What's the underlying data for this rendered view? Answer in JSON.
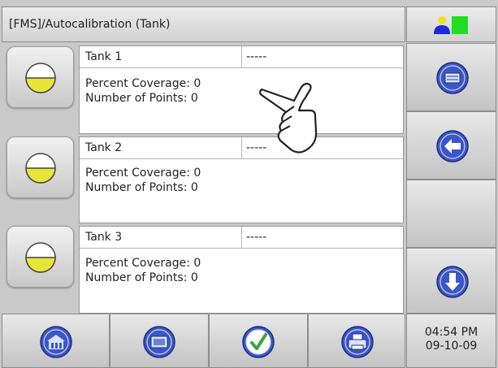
{
  "title": "[FMS]/Autocalibration (Tank)",
  "tanks": [
    {
      "name": "Tank 1",
      "value": "-----",
      "coverage": "Percent Coverage: 0",
      "points": "Number of Points: 0"
    },
    {
      "name": "Tank 2",
      "value": "-----",
      "coverage": "Percent Coverage: 0",
      "points": "Number of Points: 0"
    },
    {
      "name": "Tank 3",
      "value": "-----",
      "coverage": "Percent Coverage: 0",
      "points": "Number of Points: 0"
    }
  ],
  "clock": {
    "time": "04:54 PM",
    "date": "09-10-09"
  },
  "icons": {
    "user": "user-status-icon",
    "menu": "menu-icon",
    "back": "back-arrow-icon",
    "down": "down-arrow-icon",
    "home": "home-icon",
    "screen": "screen-icon",
    "accept": "checkmark-icon",
    "print": "printer-icon",
    "tank": "tank-level-icon",
    "pointer": "hand-pointer-icon"
  },
  "colors": {
    "accent_blue": "#3b56c8",
    "tank_yellow": "#e8e53a",
    "check_green": "#3aa53a",
    "user_green": "#22dd22",
    "user_blue": "#1d2bd8",
    "user_yellow": "#f0e020"
  }
}
